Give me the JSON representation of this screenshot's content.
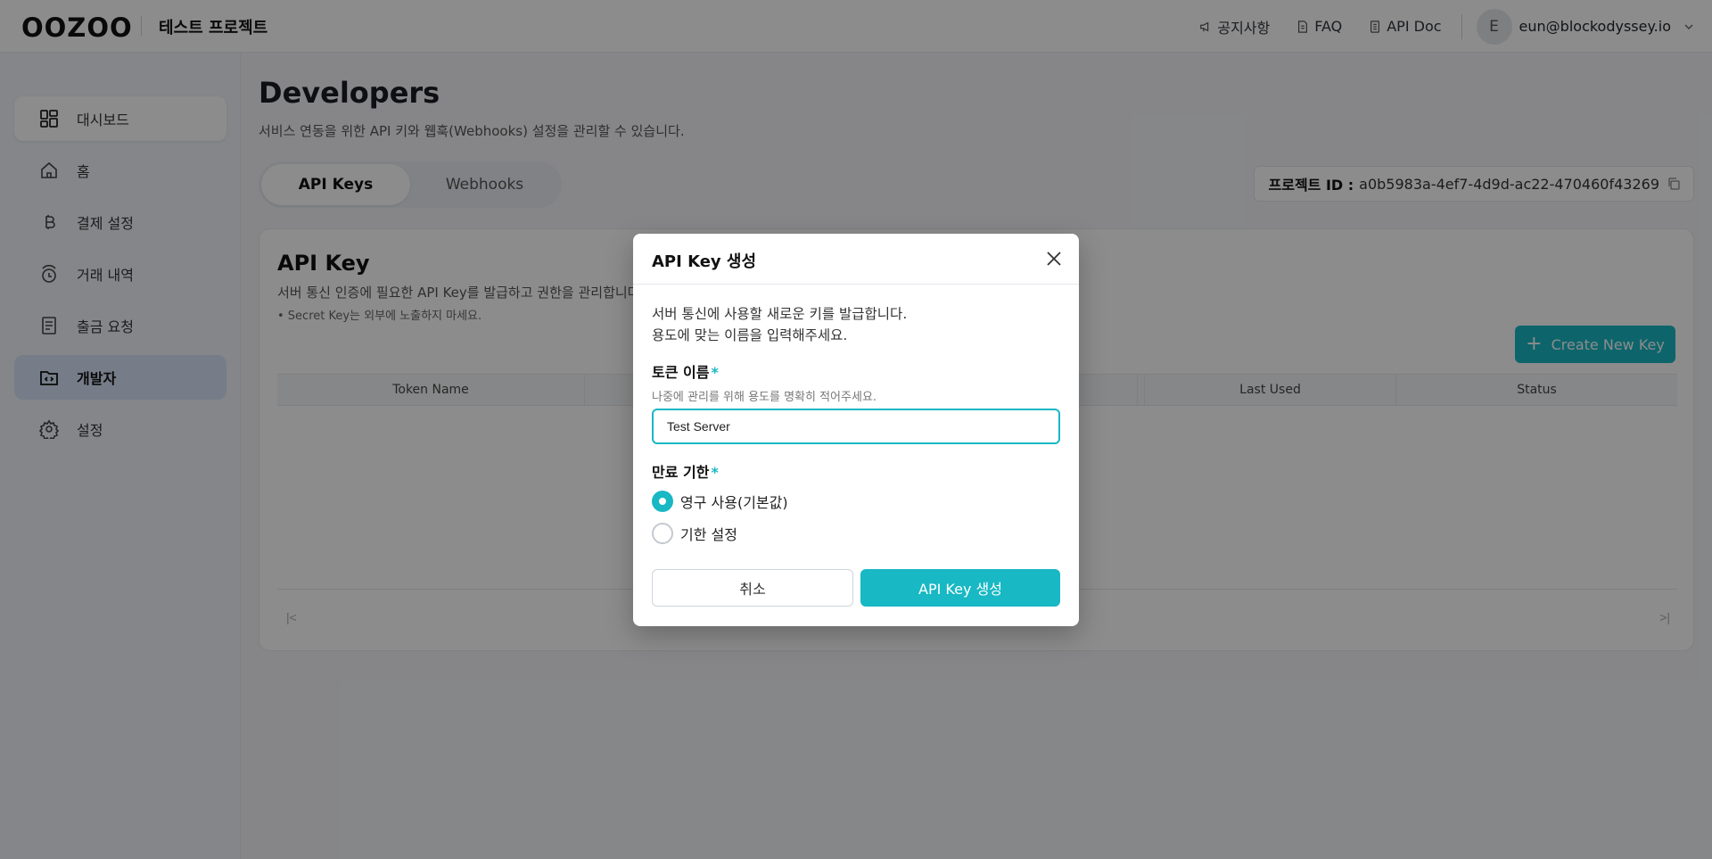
{
  "header": {
    "logo": "OOZOO",
    "project_name": "테스트 프로젝트",
    "links": {
      "notice": "공지사항",
      "faq": "FAQ",
      "api_doc": "API Doc"
    },
    "user": {
      "initial": "E",
      "email": "eun@blockodyssey.io"
    }
  },
  "sidebar": {
    "items": [
      {
        "label": "대시보드",
        "icon": "dashboard-icon"
      },
      {
        "label": "홈",
        "icon": "home-icon"
      },
      {
        "label": "결제 설정",
        "icon": "bitcoin-icon"
      },
      {
        "label": "거래 내역",
        "icon": "transactions-icon"
      },
      {
        "label": "출금 요청",
        "icon": "document-icon"
      },
      {
        "label": "개발자",
        "icon": "developer-folder-icon"
      },
      {
        "label": "설정",
        "icon": "gear-icon"
      }
    ],
    "active": "개발자"
  },
  "main": {
    "title": "Developers",
    "subtitle": "서비스 연동을 위한 API 키와 웹훅(Webhooks) 설정을 관리할 수 있습니다.",
    "tabs": [
      {
        "label": "API Keys",
        "active": true
      },
      {
        "label": "Webhooks",
        "active": false
      }
    ],
    "project_id_label": "프로젝트 ID :",
    "project_id": "a0b5983a-4ef7-4d9d-ac22-470460f43269",
    "card": {
      "title": "API Key",
      "subtitle": "서버 통신 인증에 필요한 API Key를 발급하고 권한을 관리합니다.",
      "note": "• Secret Key는 외부에 노출하지 마세요.",
      "create_button": "Create New Key",
      "columns": [
        "Token Name",
        "",
        "",
        "",
        "Last Used",
        "Status"
      ]
    }
  },
  "modal": {
    "title": "API Key 생성",
    "description_line1": "서버 통신에 사용할 새로운 키를 발급합니다.",
    "description_line2": "용도에 맞는 이름을 입력해주세요.",
    "token_label": "토큰 이름",
    "token_help": "나중에 관리를 위해 용도를 명확히 적어주세요.",
    "token_value": "Test Server",
    "expiry_label": "만료 기한",
    "required_mark": "*",
    "options": [
      {
        "label": "영구 사용(기본값)",
        "selected": true
      },
      {
        "label": "기한 설정",
        "selected": false
      }
    ],
    "cancel_label": "취소",
    "submit_label": "API Key 생성"
  },
  "colors": {
    "accent": "#18b8c4",
    "overlay": "rgba(0,0,0,0.45)",
    "sidebar_active": "#d8e4f8"
  }
}
